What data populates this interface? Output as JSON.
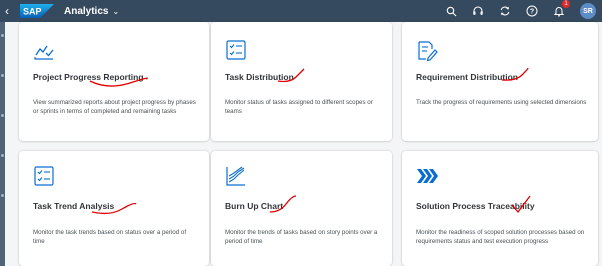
{
  "shellbar": {
    "logo_text": "SAP",
    "app_title": "Analytics",
    "notification_count": "1",
    "user_initials": "SR"
  },
  "tiles": [
    {
      "title": "Project Progress Reporting",
      "description": "View summarized reports about project progress by phases or sprints in terms of completed and remaining tasks",
      "icon": "chart-check-icon"
    },
    {
      "title": "Task Distribution",
      "description": "Monitor status of tasks assigned to different scopes or teams",
      "icon": "checklist-icon"
    },
    {
      "title": "Requirement Distribution",
      "description": "Track the progress of requirements using selected dimensions",
      "icon": "document-edit-icon"
    },
    {
      "title": "Task Trend Analysis",
      "description": "Monitor the task trends based on status over a period of time",
      "icon": "checklist-icon"
    },
    {
      "title": "Burn Up Chart",
      "description": "Monitor the trends of tasks based on story points over a period of time",
      "icon": "burn-up-chart-icon"
    },
    {
      "title": "Solution Process Traceability",
      "description": "Monitor the readiness of scoped solution processes based on requirements status and test execution progress",
      "icon": "chevrons-forward-icon"
    }
  ],
  "colors": {
    "shellbar": "#354a5f",
    "icon_blue": "#0a6ed1",
    "annotation_red": "#e00000"
  }
}
